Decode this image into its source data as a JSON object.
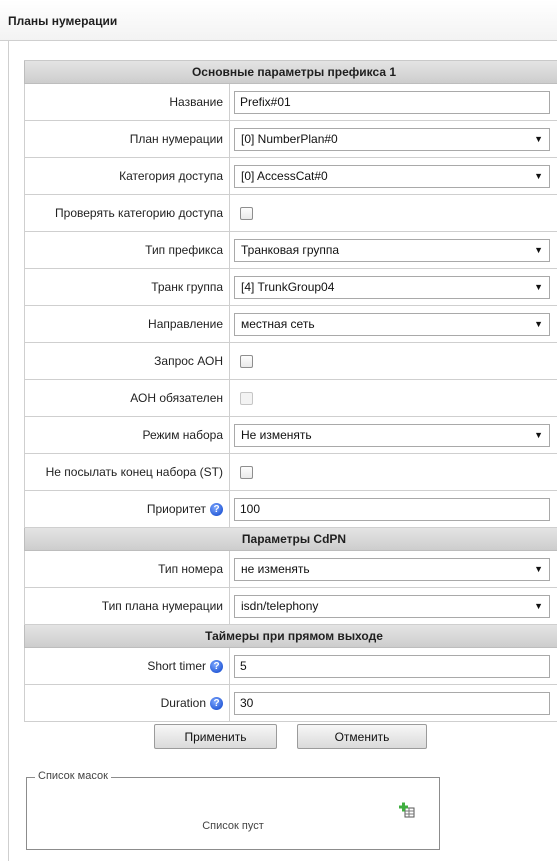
{
  "page": {
    "title": "Планы нумерации"
  },
  "sections": {
    "main": "Основные параметры префикса 1",
    "cdpn": "Параметры CdPN",
    "timers": "Таймеры при прямом выходе"
  },
  "fields": {
    "name": {
      "label": "Название",
      "value": "Prefix#01"
    },
    "numbering_plan": {
      "label": "План нумерации",
      "value": "[0] NumberPlan#0"
    },
    "access_category": {
      "label": "Категория доступа",
      "value": "[0] AccessCat#0"
    },
    "check_access_category": {
      "label": "Проверять категорию доступа",
      "checked": false
    },
    "prefix_type": {
      "label": "Тип префикса",
      "value": "Транковая группа"
    },
    "trunk_group": {
      "label": "Транк группа",
      "value": "[4] TrunkGroup04"
    },
    "direction": {
      "label": "Направление",
      "value": "местная сеть"
    },
    "aon_request": {
      "label": "Запрос АОН",
      "checked": false
    },
    "aon_required": {
      "label": "АОН обязателен",
      "checked": false,
      "disabled": true
    },
    "dial_mode": {
      "label": "Режим набора",
      "value": "Не изменять"
    },
    "no_send_st": {
      "label": "Не посылать конец набора (ST)",
      "checked": false
    },
    "priority": {
      "label": "Приоритет",
      "value": "100"
    },
    "number_type": {
      "label": "Тип номера",
      "value": "не изменять"
    },
    "numbering_plan_type": {
      "label": "Тип плана нумерации",
      "value": "isdn/telephony"
    },
    "short_timer": {
      "label": "Short timer",
      "value": "5"
    },
    "duration": {
      "label": "Duration",
      "value": "30"
    }
  },
  "buttons": {
    "apply": "Применить",
    "cancel": "Отменить"
  },
  "mask_list": {
    "legend": "Список масок",
    "empty": "Список пуст",
    "add_icon": "add-list-icon"
  },
  "help_glyph": "?",
  "caret_glyph": "▼"
}
